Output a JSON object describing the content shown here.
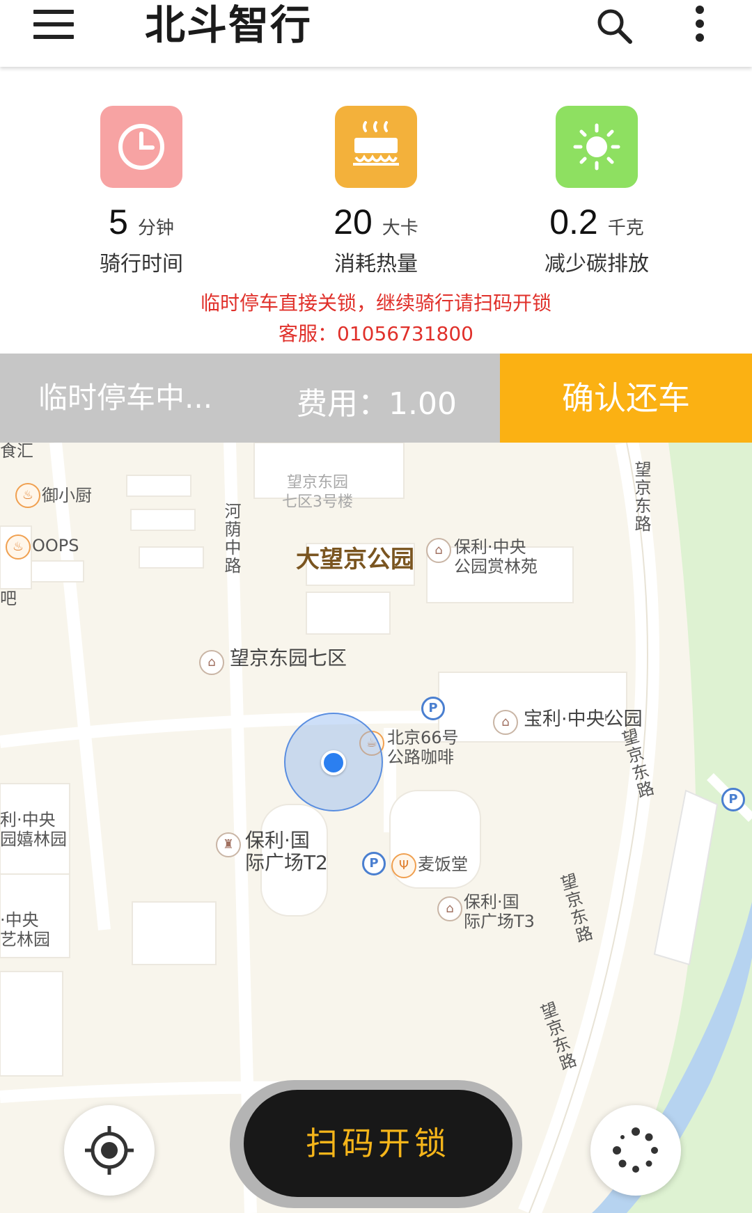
{
  "appbar": {
    "title": "北斗智行"
  },
  "stats": [
    {
      "value": "5",
      "unit": "分钟",
      "label": "骑行时间",
      "color": "#f7a3a3"
    },
    {
      "value": "20",
      "unit": "大卡",
      "label": "消耗热量",
      "color": "#f3b13b"
    },
    {
      "value": "0.2",
      "unit": "千克",
      "label": "减少碳排放",
      "color": "#8ee061"
    }
  ],
  "notice": {
    "line1": "临时停车直接关锁，继续骑行请扫码开锁",
    "line2": "客服：01056731800"
  },
  "status": {
    "text": "临时停车中...",
    "fee": "费用：1.00",
    "return_label": "确认还车"
  },
  "map": {
    "labels": {
      "l_yuhui": "食汇",
      "l_yuxiaochu": "御小厨",
      "l_oops": "OOPS",
      "l_ba": "吧",
      "l_wj73": "望京东园\n七区3号楼",
      "l_heyin": "河荫中路",
      "l_dawangjing": "大望京公园",
      "l_baoli1": "保利·中央\n公园赏林苑",
      "l_wjdl_top": "望京东路",
      "l_wj7": "望京东园七区",
      "l_baoli_zy": "宝利·中央公园",
      "l_bj66": "北京66号\n公路咖啡",
      "l_li_zy": "利·中央\n园嬉林园",
      "l_baoli_t2": "保利·国\n际广场T2",
      "l_maifan": "麦饭堂",
      "l_baoli_t3": "保利·国\n际广场T3",
      "l_zy_yilin": "·中央\n艺林园",
      "l_wjdl_mid": "望京东路",
      "l_wjdl_mid2": "望京东路",
      "l_wjdl_bot": "望京东路"
    }
  },
  "bottom": {
    "scan_label": "扫码开锁"
  }
}
